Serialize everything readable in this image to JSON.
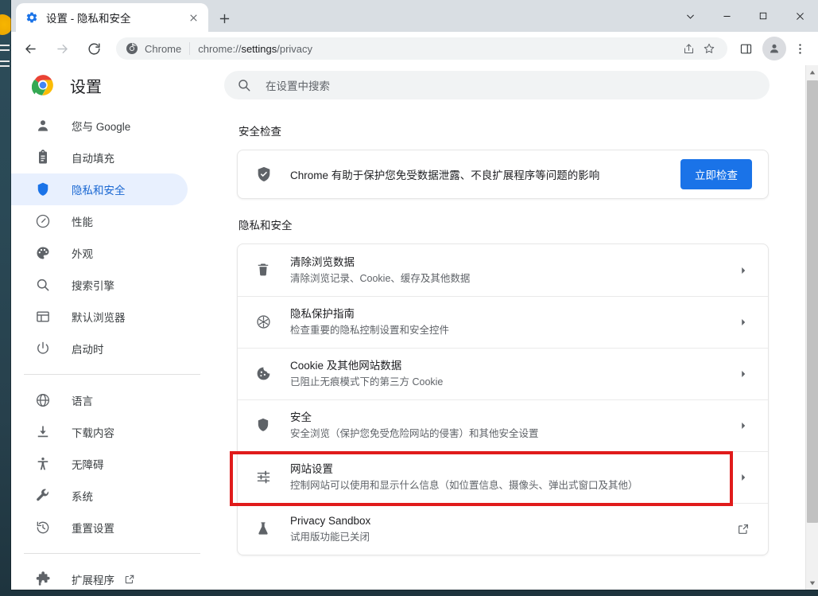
{
  "window": {
    "controls": [
      {
        "name": "minimize-to-tray",
        "glyph": "⌄"
      },
      {
        "name": "minimize",
        "glyph": "—"
      },
      {
        "name": "maximize",
        "glyph": "□"
      },
      {
        "name": "close",
        "glyph": "✕"
      }
    ]
  },
  "tab": {
    "title": "设置 - 隐私和安全",
    "close_glyph": "✕",
    "new_tab_glyph": "+"
  },
  "toolbar": {
    "back_glyph": "←",
    "forward_glyph": "→",
    "reload_glyph": "↻",
    "omnibox": {
      "chip_label": "Chrome",
      "url_prefix": "chrome://",
      "url_bold": "settings",
      "url_suffix": "/privacy"
    },
    "share_glyph": "➦",
    "bookmark_glyph": "☆",
    "sidepanel_glyph": "▣",
    "menu_glyph": "⋮"
  },
  "settings_header": {
    "title": "设置",
    "search_placeholder": "在设置中搜索"
  },
  "sidebar": {
    "groups": [
      {
        "items": [
          {
            "label": "您与 Google",
            "icon": "person-icon",
            "active": false
          },
          {
            "label": "自动填充",
            "icon": "clipboard-icon",
            "active": false
          },
          {
            "label": "隐私和安全",
            "icon": "shield-icon",
            "active": true
          },
          {
            "label": "性能",
            "icon": "speedometer-icon",
            "active": false
          },
          {
            "label": "外观",
            "icon": "palette-icon",
            "active": false
          },
          {
            "label": "搜索引擎",
            "icon": "search-icon",
            "active": false
          },
          {
            "label": "默认浏览器",
            "icon": "browser-window-icon",
            "active": false
          },
          {
            "label": "启动时",
            "icon": "power-icon",
            "active": false
          }
        ]
      },
      {
        "items": [
          {
            "label": "语言",
            "icon": "globe-icon",
            "active": false
          },
          {
            "label": "下载内容",
            "icon": "download-icon",
            "active": false
          },
          {
            "label": "无障碍",
            "icon": "accessibility-icon",
            "active": false
          },
          {
            "label": "系统",
            "icon": "wrench-icon",
            "active": false
          },
          {
            "label": "重置设置",
            "icon": "history-restore-icon",
            "active": false
          }
        ]
      },
      {
        "items": [
          {
            "label": "扩展程序",
            "icon": "puzzle-icon",
            "active": false,
            "external": true
          }
        ]
      }
    ]
  },
  "main": {
    "safety_check": {
      "section_title": "安全检查",
      "description": "Chrome 有助于保护您免受数据泄露、不良扩展程序等问题的影响",
      "button_label": "立即检查",
      "icon": "shield-check-icon"
    },
    "privacy": {
      "section_title": "隐私和安全",
      "rows": [
        {
          "icon": "trash-icon",
          "title": "清除浏览数据",
          "subtitle": "清除浏览记录、Cookie、缓存及其他数据",
          "end_icon": "chevron-right-icon",
          "highlighted": false
        },
        {
          "icon": "privacy-guide-icon",
          "title": "隐私保护指南",
          "subtitle": "检查重要的隐私控制设置和安全控件",
          "end_icon": "chevron-right-icon",
          "highlighted": false
        },
        {
          "icon": "cookie-icon",
          "title": "Cookie 及其他网站数据",
          "subtitle": "已阻止无痕模式下的第三方 Cookie",
          "end_icon": "chevron-right-icon",
          "highlighted": false
        },
        {
          "icon": "shield-icon",
          "title": "安全",
          "subtitle": "安全浏览（保护您免受危险网站的侵害）和其他安全设置",
          "end_icon": "chevron-right-icon",
          "highlighted": false
        },
        {
          "icon": "tune-icon",
          "title": "网站设置",
          "subtitle": "控制网站可以使用和显示什么信息（如位置信息、摄像头、弹出式窗口及其他）",
          "end_icon": "chevron-right-icon",
          "highlighted": true
        },
        {
          "icon": "flask-icon",
          "title": "Privacy Sandbox",
          "subtitle": "试用版功能已关闭",
          "end_icon": "open-in-new-icon",
          "highlighted": false
        }
      ]
    }
  },
  "colors": {
    "accent": "#1a73e8",
    "active_nav_bg": "#e8f0fe",
    "active_nav_fg": "#1967d2",
    "highlight_box": "#e01b1b",
    "text_primary": "#202124",
    "text_secondary": "#5f6368"
  },
  "scrollbar": {
    "up_glyph": "▲",
    "down_glyph": "▼"
  }
}
